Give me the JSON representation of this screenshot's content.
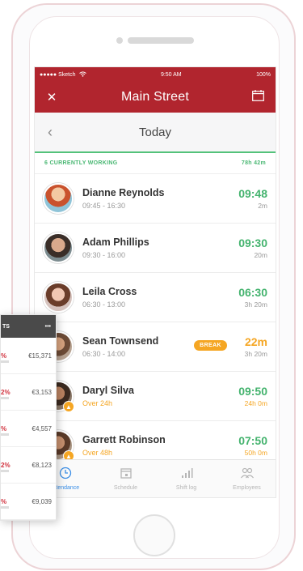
{
  "status_bar": {
    "carrier": "●●●●● Sketch",
    "time": "9:50 AM",
    "battery": "100%"
  },
  "nav": {
    "title": "Main Street",
    "close_icon": "✕",
    "calendar_icon": "calendar-icon"
  },
  "date_bar": {
    "chevron": "‹",
    "label": "Today"
  },
  "summary": {
    "working_label": "6 CURRENTLY WORKING",
    "total": "78h 42m"
  },
  "employees": [
    {
      "name": "Dianne Reynolds",
      "shift": "09:45 - 16:30",
      "time": "09:48",
      "sub": "2m",
      "warning": false
    },
    {
      "name": "Adam Phillips",
      "shift": "09:30 - 16:00",
      "time": "09:30",
      "sub": "20m",
      "warning": false
    },
    {
      "name": "Leila Cross",
      "shift": "06:30 - 13:00",
      "time": "06:30",
      "sub": "3h 20m",
      "warning": false
    },
    {
      "name": "Sean Townsend",
      "shift": "06:30 - 14:00",
      "time": "22m",
      "sub": "3h 20m",
      "warning": false,
      "badge": "BREAK"
    },
    {
      "name": "Daryl Silva",
      "shift": "Over 24h",
      "time": "09:50",
      "sub": "24h 0m",
      "warning": true
    },
    {
      "name": "Garrett Robinson",
      "shift": "Over 48h",
      "time": "07:50",
      "sub": "50h 0m",
      "warning": true
    }
  ],
  "tabs": [
    {
      "label": "Attendance",
      "icon": "clock-icon",
      "active": true
    },
    {
      "label": "Schedule",
      "icon": "calendar-icon",
      "active": false
    },
    {
      "label": "Shift log",
      "icon": "bar-chart-icon",
      "active": false
    },
    {
      "label": "Employees",
      "icon": "people-icon",
      "active": false
    }
  ],
  "card": {
    "header": "TS",
    "menu": "•••",
    "rows": [
      {
        "pct": "%",
        "amount": "€15,371"
      },
      {
        "pct": "2%",
        "amount": "€3,153"
      },
      {
        "pct": "%",
        "amount": "€4,557"
      },
      {
        "pct": "2%",
        "amount": "€8,123"
      },
      {
        "pct": "%",
        "amount": "€9,039"
      }
    ]
  },
  "colors": {
    "brand": "#b1252e",
    "green": "#44b36e",
    "orange": "#f5a623",
    "active_tab": "#3a8ee6"
  }
}
